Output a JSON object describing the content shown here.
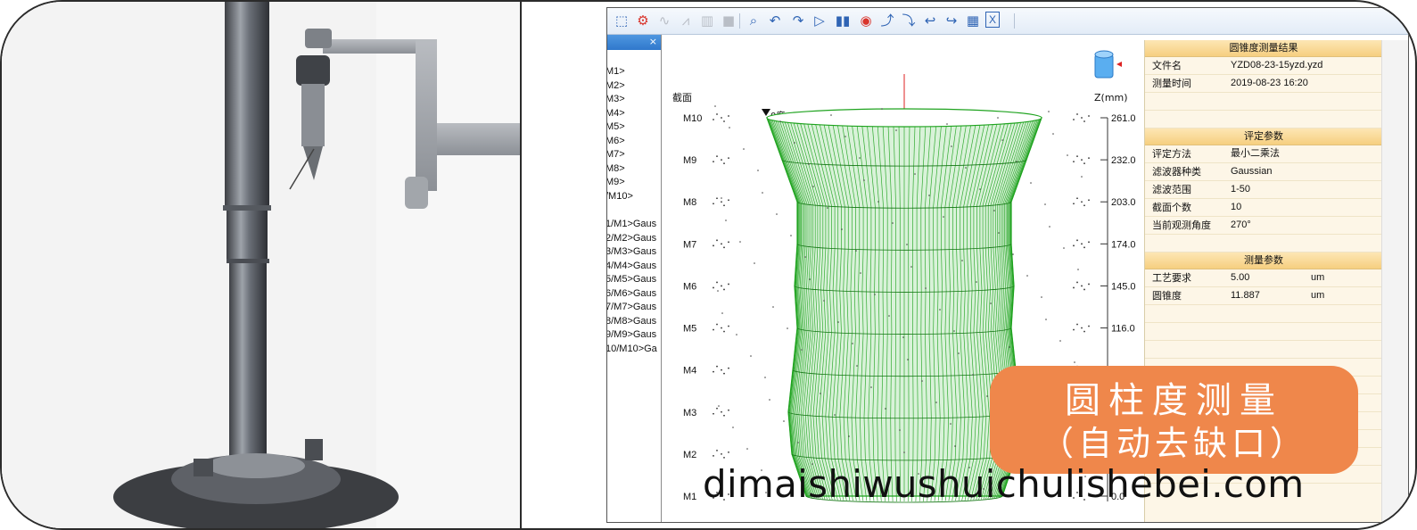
{
  "toolbar": {
    "icons": [
      "select-rect-icon",
      "select-settings-icon",
      "wave-icon",
      "chart-line-icon",
      "histogram-icon",
      "stop-icon",
      "zoom-icon",
      "undo-rotate-icon",
      "redo-rotate-icon",
      "play-icon",
      "columns-icon",
      "record-icon",
      "arrow-up-right-icon",
      "arrow-down-right-icon",
      "undo-icon",
      "redo-icon",
      "save-icon",
      "excel-icon"
    ]
  },
  "tree": {
    "close_label": "×",
    "sections": [
      "M1>",
      "M2>",
      "M3>",
      "M4>",
      "M5>",
      "M6>",
      "M7>",
      "M8>",
      "M9>",
      "/M10>"
    ],
    "filtered": [
      "1/M1>Gaus",
      "2/M2>Gaus",
      "3/M3>Gaus",
      "4/M4>Gaus",
      "5/M5>Gaus",
      "6/M6>Gaus",
      "7/M7>Gaus",
      "8/M8>Gaus",
      "9/M9>Gaus",
      "10/M10>Ga"
    ]
  },
  "plot": {
    "section_label": "截面",
    "z_label": "Z(mm)",
    "angle_label": "0度",
    "rows": [
      {
        "name": "M10",
        "z": "261.0"
      },
      {
        "name": "M9",
        "z": "232.0"
      },
      {
        "name": "M8",
        "z": "203.0"
      },
      {
        "name": "M7",
        "z": "174.0"
      },
      {
        "name": "M6",
        "z": "145.0"
      },
      {
        "name": "M5",
        "z": "116.0"
      },
      {
        "name": "M4",
        "z": ""
      },
      {
        "name": "M3",
        "z": ""
      },
      {
        "name": "M2",
        "z": ""
      },
      {
        "name": "M1",
        "z": "0.0"
      }
    ],
    "mesh_color": "#1fa31f"
  },
  "results": {
    "title": "圆锥度测量结果",
    "file_label": "文件名",
    "file_value": "YZD08-23-15yzd.yzd",
    "time_label": "测量时间",
    "time_value": "2019-08-23 16:20",
    "eval_title": "评定参数",
    "eval": [
      {
        "k": "评定方法",
        "v": "最小二乘法"
      },
      {
        "k": "滤波器种类",
        "v": "Gaussian"
      },
      {
        "k": "滤波范围",
        "v": "1-50"
      },
      {
        "k": "截面个数",
        "v": "10"
      },
      {
        "k": "当前观测角度",
        "v": "270°"
      }
    ],
    "meas_title": "测量参数",
    "meas": [
      {
        "k": "工艺要求",
        "v": "5.00",
        "u": "um"
      },
      {
        "k": "圆锥度",
        "v": "11.887",
        "u": "um"
      }
    ]
  },
  "badge": {
    "line1": "圆柱度测量",
    "line2": "（自动去缺口）",
    "color": "#ef874b"
  },
  "watermark": "dimaishiwushuichulishebei.com"
}
